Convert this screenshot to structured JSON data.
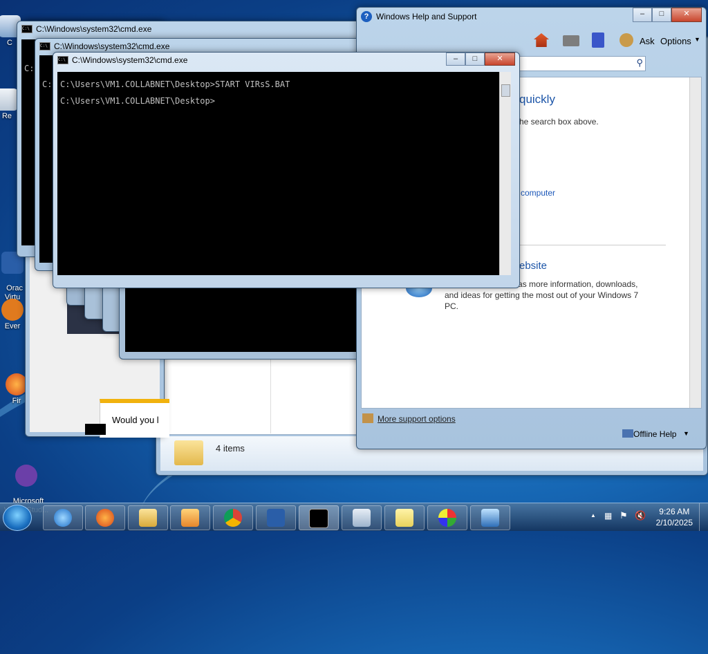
{
  "desktop": {
    "icons": [
      {
        "label": "C",
        "icon": "computer-icon"
      },
      {
        "label": "Re",
        "icon": "recycle-bin-icon"
      },
      {
        "label": "Orac\nVirtu",
        "icon": "virtualbox-icon"
      },
      {
        "label": "Ever",
        "icon": "everything-icon"
      },
      {
        "label": "Fir",
        "icon": "firefox-icon"
      },
      {
        "label": "Microsoft\nVisual Stud...",
        "icon": "visual-studio-icon"
      }
    ]
  },
  "cmd_windows": [
    {
      "title": "C:\\Windows\\system32\\cmd.exe"
    },
    {
      "title": "C:\\Windows\\system32\\cmd.exe"
    },
    {
      "title": "C:\\Windows\\system32\\cmd.exe"
    }
  ],
  "cmd_prompt_peek": [
    "C:",
    "C:",
    "C:"
  ],
  "cmd_front": {
    "lines": [
      "C:\\Users\\VM1.COLLABNET\\Desktop>START VIRsS.BAT",
      "C:\\Users\\VM1.COLLABNET\\Desktop>"
    ]
  },
  "explorer": {
    "status": "4 items",
    "dialog_text": "Would you l"
  },
  "help": {
    "title": "Windows Help and Support",
    "toolbar": {
      "ask": "Ask",
      "options": "Options"
    },
    "section1_heading": "quickly",
    "section1_text": "he search box above.",
    "section1_link": "computer",
    "section2_heading": "ebsite",
    "section2_text": "ws website, which has more information, downloads, and ideas for getting the most out of your Windows 7 PC.",
    "more_support": "More support options",
    "offline_help": "Offline Help"
  },
  "taskbar": {
    "items": [
      "internet-explorer-icon",
      "firefox-icon",
      "explorer-folder-icon",
      "media-player-icon",
      "chrome-icon",
      "virtualbox-icon",
      "cmd-icon",
      "calculator-icon",
      "sticky-notes-icon",
      "paint-icon",
      "remote-desktop-icon"
    ],
    "time": "9:26 AM",
    "date": "2/10/2025"
  }
}
